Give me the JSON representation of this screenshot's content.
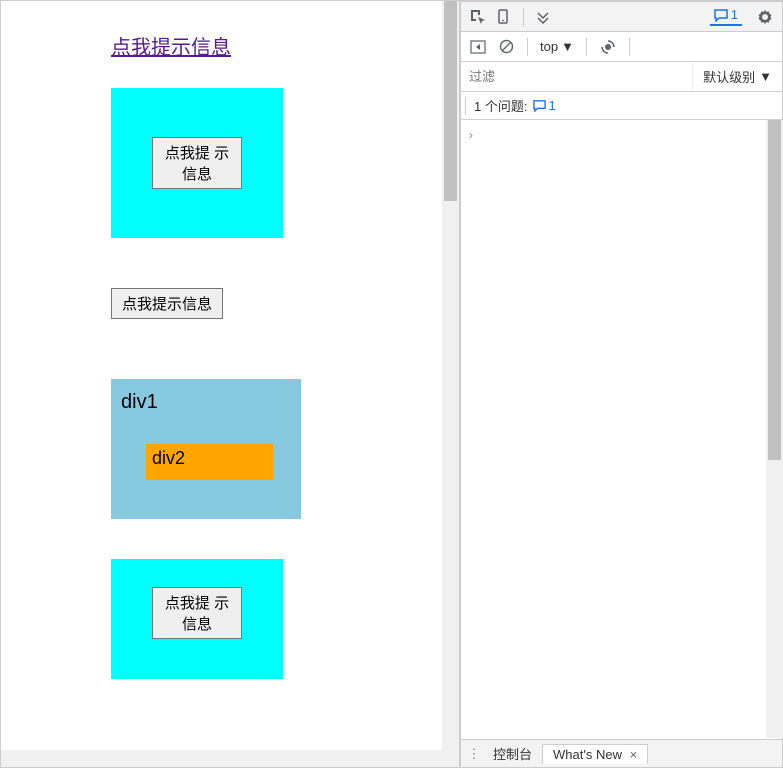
{
  "page": {
    "link_text": "点我提示信息",
    "button1": "点我提\n示信息",
    "button2": "点我提示信息",
    "div1_label": "div1",
    "div2_label": "div2",
    "button3": "点我提\n示信息"
  },
  "devtools": {
    "toolbar1": {
      "issue_count": "1"
    },
    "toolbar2": {
      "context": "top"
    },
    "filter_placeholder": "过滤",
    "level_label": "默认级别",
    "issues_bar": {
      "text": "1 个问题:",
      "count": "1"
    },
    "tabs": {
      "console": "控制台",
      "whatsnew": "What's New"
    }
  }
}
